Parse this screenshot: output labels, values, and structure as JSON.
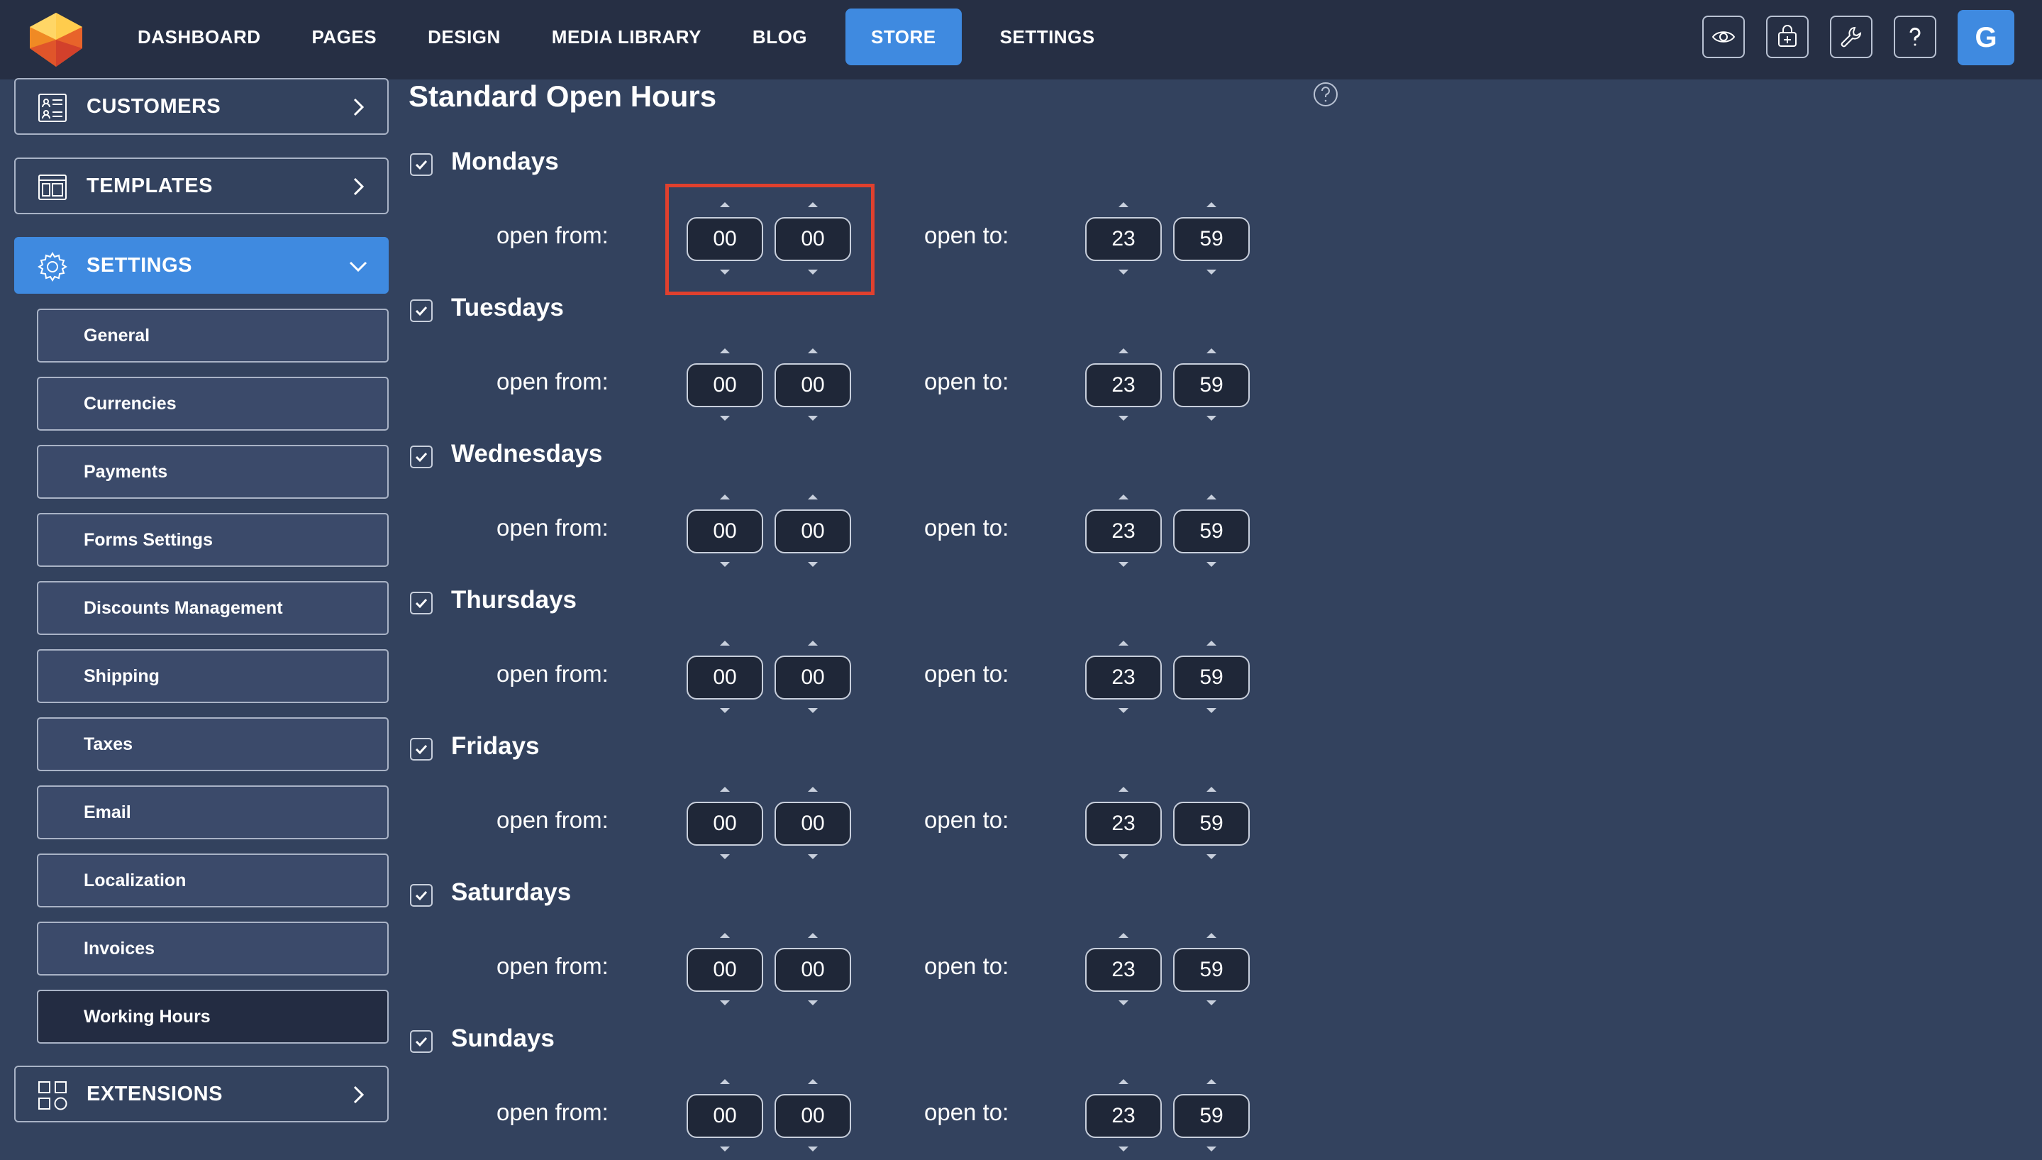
{
  "topbar": {
    "nav": [
      {
        "label": "DASHBOARD",
        "active": false
      },
      {
        "label": "PAGES",
        "active": false
      },
      {
        "label": "DESIGN",
        "active": false
      },
      {
        "label": "MEDIA LIBRARY",
        "active": false
      },
      {
        "label": "BLOG",
        "active": false
      },
      {
        "label": "STORE",
        "active": true
      },
      {
        "label": "SETTINGS",
        "active": false
      }
    ],
    "tools": [
      "eye-icon",
      "bag-add-icon",
      "wrench-icon",
      "question-icon"
    ],
    "avatar_letter": "G",
    "accent_color": "#3f8ae0"
  },
  "sidebar": {
    "customers": "CUSTOMERS",
    "templates": "TEMPLATES",
    "settings": "SETTINGS",
    "extensions": "EXTENSIONS",
    "settings_items": [
      "General",
      "Currencies",
      "Payments",
      "Forms Settings",
      "Discounts Management",
      "Shipping",
      "Taxes",
      "Email",
      "Localization",
      "Invoices",
      "Working Hours"
    ],
    "active_item": "Working Hours"
  },
  "main": {
    "title": "Standard Open Hours",
    "open_from_label": "open from:",
    "open_to_label": "open to:",
    "days": [
      {
        "name": "Mondays",
        "checked": true,
        "from_h": "00",
        "from_m": "00",
        "to_h": "23",
        "to_m": "59"
      },
      {
        "name": "Tuesdays",
        "checked": true,
        "from_h": "00",
        "from_m": "00",
        "to_h": "23",
        "to_m": "59"
      },
      {
        "name": "Wednesdays",
        "checked": true,
        "from_h": "00",
        "from_m": "00",
        "to_h": "23",
        "to_m": "59"
      },
      {
        "name": "Thursdays",
        "checked": true,
        "from_h": "00",
        "from_m": "00",
        "to_h": "23",
        "to_m": "59"
      },
      {
        "name": "Fridays",
        "checked": true,
        "from_h": "00",
        "from_m": "00",
        "to_h": "23",
        "to_m": "59"
      },
      {
        "name": "Saturdays",
        "checked": true,
        "from_h": "00",
        "from_m": "00",
        "to_h": "23",
        "to_m": "59"
      },
      {
        "name": "Sundays",
        "checked": true,
        "from_h": "00",
        "from_m": "00",
        "to_h": "23",
        "to_m": "59"
      }
    ],
    "highlight_color": "#e0402e"
  }
}
